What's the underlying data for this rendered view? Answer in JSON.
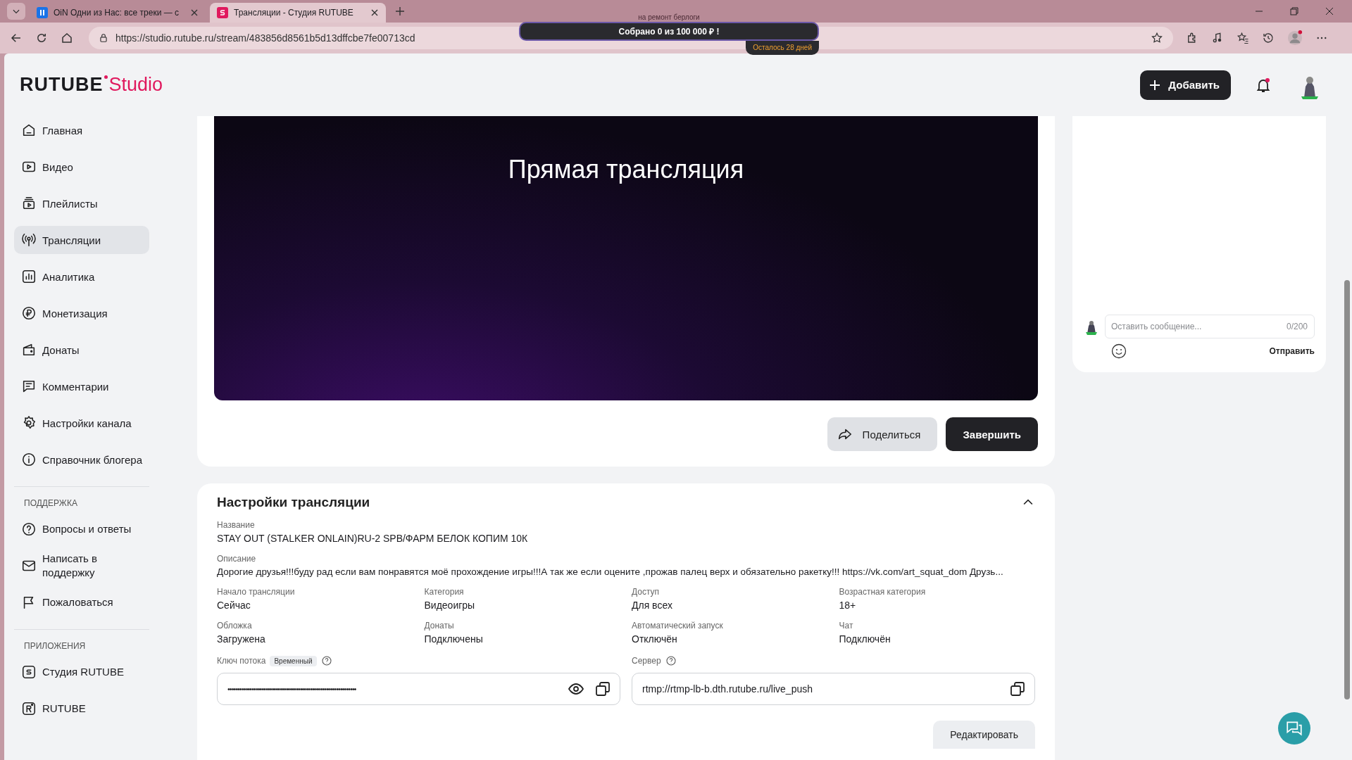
{
  "browser": {
    "tabs": [
      {
        "title": "OiN Одни из Нас: все треки — с",
        "selected": false,
        "kind": "media"
      },
      {
        "title": "Трансляции - Студия RUTUBE",
        "selected": true,
        "kind": "studio"
      }
    ],
    "url": "https://studio.rutube.ru/stream/483856d8561b5d13dffcbe7fe00713cd"
  },
  "donation_overlay": {
    "caption": "на ремонт берлоги",
    "title": "Собрано 0  из 100 000 ₽ !",
    "remaining": "Осталось 28 дней"
  },
  "header": {
    "logo_brand": "RUTUBE",
    "logo_suffix": "Studio",
    "add_button": "Добавить",
    "notifications": true
  },
  "sidebar": {
    "items": [
      {
        "label": "Главная",
        "selected": false
      },
      {
        "label": "Видео",
        "selected": false
      },
      {
        "label": "Плейлисты",
        "selected": false
      },
      {
        "label": "Трансляции",
        "selected": true
      },
      {
        "label": "Аналитика",
        "selected": false
      },
      {
        "label": "Монетизация",
        "selected": false
      },
      {
        "label": "Донаты",
        "selected": false
      },
      {
        "label": "Комментарии",
        "selected": false
      },
      {
        "label": "Настройки канала",
        "selected": false
      },
      {
        "label": "Справочник блогера",
        "selected": false
      }
    ],
    "sections": [
      {
        "heading": "ПОДДЕРЖКА",
        "items": [
          {
            "label": "Вопросы и ответы",
            "selected": false
          },
          {
            "label": "Написать в поддержку",
            "selected": false
          },
          {
            "label": "Пожаловаться",
            "selected": false
          }
        ]
      },
      {
        "heading": "ПРИЛОЖЕНИЯ",
        "items": [
          {
            "label": "Студия RUTUBE",
            "selected": false
          },
          {
            "label": "RUTUBE",
            "selected": false
          }
        ]
      }
    ]
  },
  "player": {
    "title": "Прямая трансляция"
  },
  "actions": {
    "share": "Поделиться",
    "finish": "Завершить"
  },
  "settings": {
    "title": "Настройки трансляции",
    "expanded": true,
    "name": {
      "label": "Название",
      "value": "STAY OUT (STALKER ONLAIN)RU-2 SPB/ФАРМ БЕЛОК КОПИМ 10К"
    },
    "description": {
      "label": "Описание",
      "value": "Дорогие друзья!!!буду рад если вам понравятся моё прохождение игры!!!А так же если оцените ,прожав палец верх и обязательно ракетку!!! https://vk.com/art_squat_dom Друзь..."
    },
    "fields": [
      {
        "label": "Начало трансляции",
        "value": "Сейчас"
      },
      {
        "label": "Категория",
        "value": "Видеоигры"
      },
      {
        "label": "Доступ",
        "value": "Для всех"
      },
      {
        "label": "Возрастная категория",
        "value": "18+"
      },
      {
        "label": "Обложка",
        "value": "Загружена"
      },
      {
        "label": "Донаты",
        "value": "Подключены"
      },
      {
        "label": "Автоматический запуск",
        "value": "Отключён"
      },
      {
        "label": "Чат",
        "value": "Подключён"
      }
    ],
    "stream_key": {
      "label": "Ключ потока",
      "badge": "Временный",
      "value": "••••••••••••••••••••••••••••••••••••••••••••••••••••••••••••••••"
    },
    "server": {
      "label": "Сервер",
      "value": "rtmp://rtmp-lb-b.dth.rutube.ru/live_push"
    },
    "edit_button": "Редактировать"
  },
  "chat": {
    "placeholder": "Оставить сообщение...",
    "counter": "0/200",
    "send": "Отправить"
  }
}
